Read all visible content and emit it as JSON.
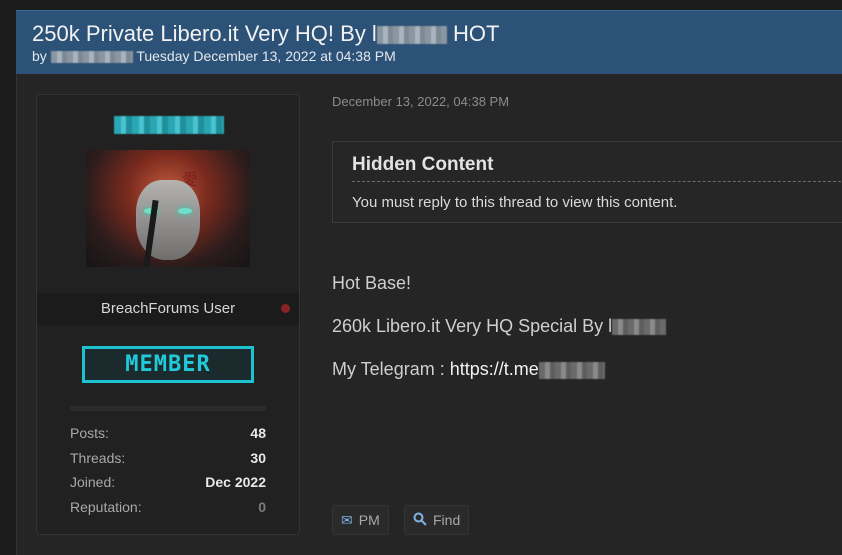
{
  "thread": {
    "title_prefix": "250k Private Libero.it Very HQ! By l",
    "title_suffix": "HOT",
    "by_label": "by",
    "date_text": "Tuesday December 13, 2022 at 04:38 PM"
  },
  "profile": {
    "role": "BreachForums User",
    "badge": "MEMBER",
    "stats": [
      {
        "label": "Posts:",
        "value": "48"
      },
      {
        "label": "Threads:",
        "value": "30"
      },
      {
        "label": "Joined:",
        "value": "Dec 2022"
      },
      {
        "label": "Reputation:",
        "value": "0"
      }
    ]
  },
  "post": {
    "date": "December 13, 2022, 04:38 PM",
    "hidden_title": "Hidden Content",
    "hidden_msg": "You must reply to this thread to view this content.",
    "line1": "Hot Base!",
    "line2_prefix": "260k Libero.it Very HQ Special By l",
    "line3_prefix": "My Telegram : ",
    "line3_link": "https://t.me"
  },
  "buttons": {
    "pm": "PM",
    "find": "Find"
  },
  "colors": {
    "header_bg": "#2c5278",
    "badge_accent": "#1cc2d2",
    "status_dot": "#8a2222"
  }
}
